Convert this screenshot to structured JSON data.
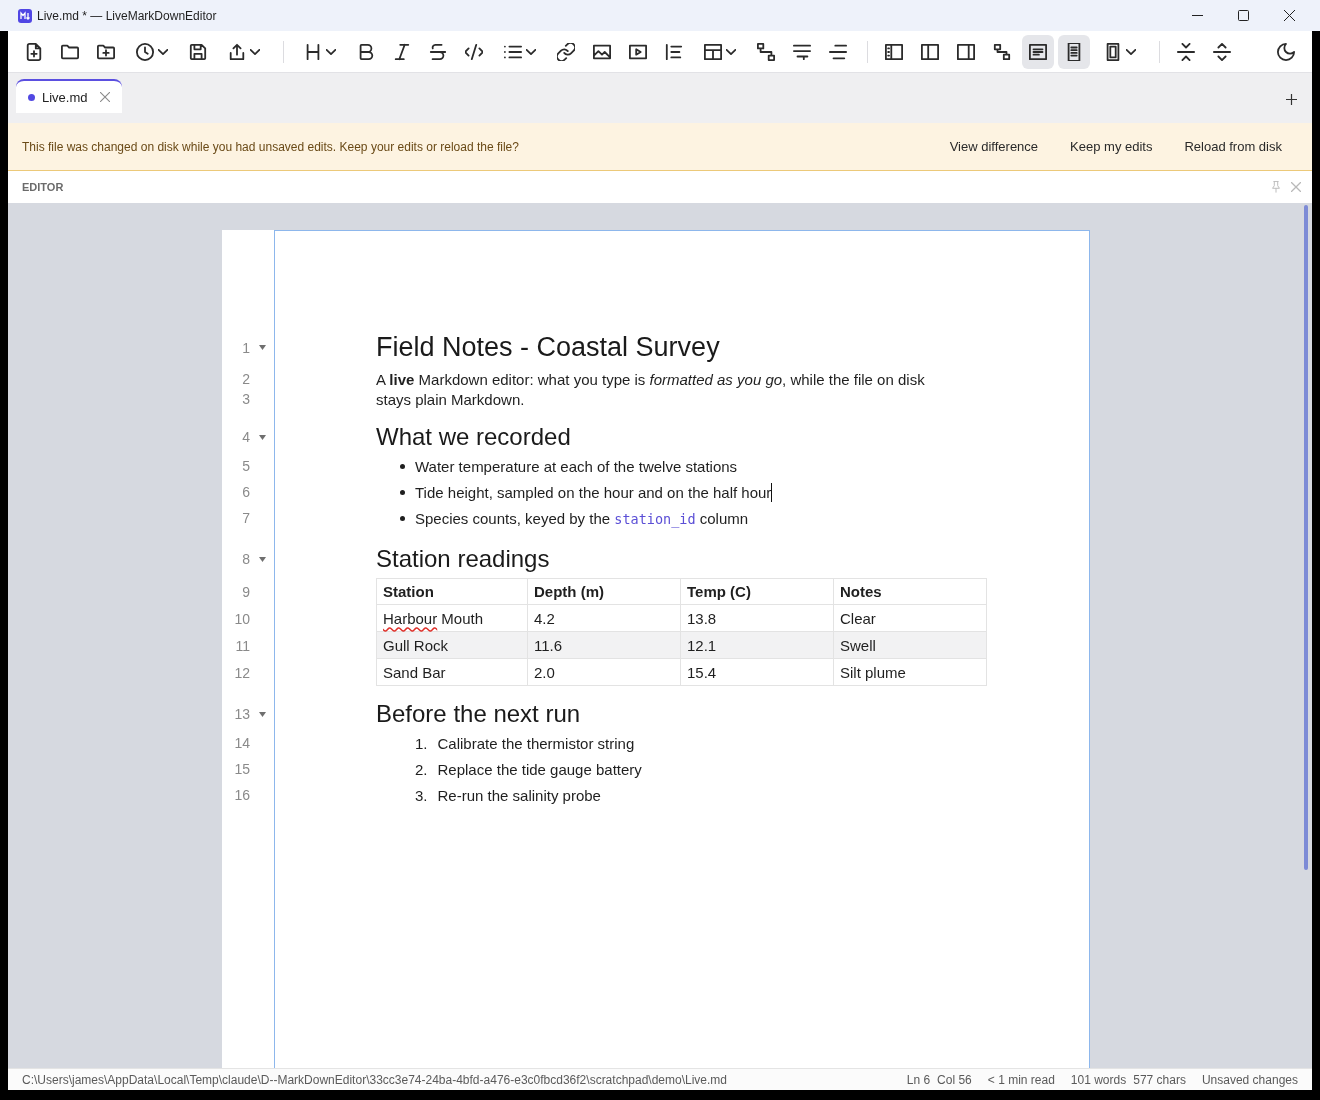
{
  "window": {
    "title": "Live.md * — LiveMarkDownEditor"
  },
  "toolbar": {
    "view_buttons": [
      {
        "selected": false
      },
      {
        "selected": false
      },
      {
        "selected": false
      },
      {
        "selected": false
      },
      {
        "selected": true
      },
      {
        "selected": true
      }
    ]
  },
  "tabs": [
    {
      "label": "Live.md",
      "selected": true,
      "modified": true
    }
  ],
  "banner": {
    "message": "This file was changed on disk while you had unsaved edits. Keep your edits or reload the file?",
    "actions": [
      "View difference",
      "Keep my edits",
      "Reload from disk"
    ]
  },
  "panel": {
    "title": "EDITOR"
  },
  "document": {
    "lines": [
      {
        "number": "1",
        "kind": "h1",
        "text": "Field Notes - Coastal Survey",
        "caret": false
      },
      {
        "number": "2",
        "kind": "paragraph",
        "text": "A **live** Markdown editor: what you type is *formatted as you go*, while the file on disk",
        "caret": false
      },
      {
        "number": "3",
        "kind": "paragraph",
        "text": "stays plain Markdown.",
        "caret": false
      },
      {
        "number": "4",
        "kind": "h2",
        "text": "What we recorded",
        "caret": false
      },
      {
        "number": "5",
        "kind": "bullet",
        "text": "Water temperature at each of the twelve stations",
        "caret": false
      },
      {
        "number": "6",
        "kind": "bullet",
        "text": "Tide height, sampled on the hour and on the half hour",
        "caret": true
      },
      {
        "number": "7",
        "kind": "bullet",
        "segments": [
          {
            "kind": "text",
            "text": "Species counts, keyed by the "
          },
          {
            "kind": "code",
            "text": "station_id"
          },
          {
            "kind": "text",
            "text": " column"
          }
        ],
        "caret": false
      },
      {
        "number": "8",
        "kind": "h2",
        "text": "Station readings",
        "caret": false
      },
      {
        "number": "9",
        "kind": "table_header",
        "cells": [
          "Station",
          "Depth (m)",
          "Temp (C)",
          "Notes"
        ],
        "caret": false
      },
      {
        "number": "10",
        "kind": "table_row",
        "cells": [
          [
            {
              "text": "Harbour",
              "misspelled": true
            },
            {
              "text": " Mouth",
              "misspelled": false
            }
          ],
          "4.2",
          "13.8",
          "Clear"
        ],
        "caret": false
      },
      {
        "number": "11",
        "kind": "table_row",
        "cells": [
          "Gull Rock",
          "11.6",
          "12.1",
          "Swell"
        ],
        "caret": false
      },
      {
        "number": "12",
        "kind": "table_row",
        "cells": [
          "Sand Bar",
          "2.0",
          "15.4",
          "Silt plume"
        ],
        "caret": false
      },
      {
        "number": "13",
        "kind": "h2",
        "text": "Before the next run",
        "caret": false
      },
      {
        "number": "14",
        "kind": "ordered",
        "marker": "1.",
        "text": "Calibrate the thermistor string",
        "caret": false
      },
      {
        "number": "15",
        "kind": "ordered",
        "marker": "2.",
        "text": "Replace the tide gauge battery",
        "caret": false
      },
      {
        "number": "16",
        "kind": "ordered",
        "marker": "3.",
        "text": "Re-run the salinity probe",
        "caret": false
      }
    ]
  },
  "status_bar": {
    "path": "C:\\Users\\james\\AppData\\Local\\Temp\\claude\\D--MarkDownEditor\\33cc3e74-24ba-4bfd-a476-e3c0fbcd36f2\\scratchpad\\demo\\Live.md",
    "groups": [
      [
        "Ln 6",
        "Col 56"
      ],
      [
        "< 1 min read"
      ],
      [
        "101 words",
        "577 chars"
      ],
      [
        "Unsaved changes"
      ]
    ]
  }
}
